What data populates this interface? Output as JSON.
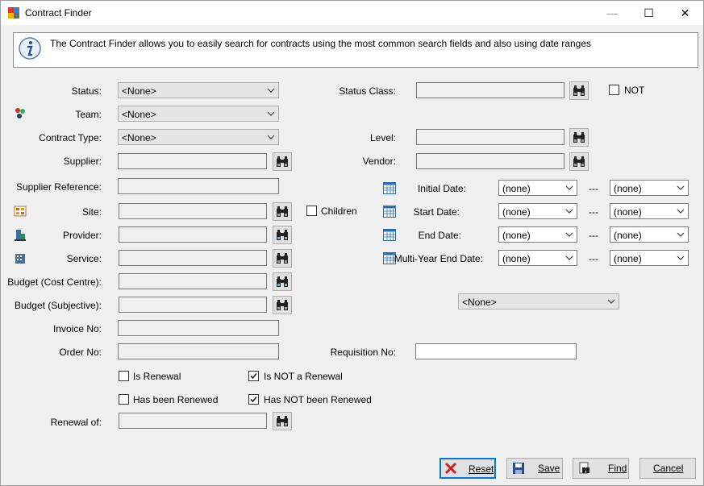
{
  "window": {
    "title": "Contract Finder",
    "minimize_glyph": "—",
    "maximize_glyph": "☐",
    "close_glyph": "✕"
  },
  "info": {
    "text": "The Contract Finder allows you to easily search for contracts using the most common search fields and also using date ranges",
    "icon": "info-icon"
  },
  "labels": {
    "status": "Status:",
    "team": "Team:",
    "contract_type": "Contract Type:",
    "supplier": "Supplier:",
    "supplier_reference": "Supplier Reference:",
    "site": "Site:",
    "provider": "Provider:",
    "service": "Service:",
    "budget_cost_centre": "Budget (Cost Centre):",
    "budget_subjective": "Budget (Subjective):",
    "invoice_no": "Invoice No:",
    "order_no": "Order No:",
    "renewal_of": "Renewal of:",
    "status_class": "Status Class:",
    "level": "Level:",
    "vendor": "Vendor:",
    "initial_date": "Initial Date:",
    "start_date": "Start Date:",
    "end_date": "End Date:",
    "multi_year_end_date": "Multi-Year End Date:",
    "requisition_no": "Requisition No:",
    "date_separator": "---"
  },
  "combos": {
    "status": "<None>",
    "team": "<None>",
    "contract_type": "<None>",
    "extra": "<None>"
  },
  "dates": {
    "initial_from": "(none)",
    "initial_to": "(none)",
    "start_from": "(none)",
    "start_to": "(none)",
    "end_from": "(none)",
    "end_to": "(none)",
    "multi_from": "(none)",
    "multi_to": "(none)"
  },
  "checkboxes": {
    "not": {
      "label": "NOT",
      "checked": false
    },
    "children": {
      "label": "Children",
      "checked": false
    },
    "is_renewal": {
      "label": "Is Renewal",
      "checked": false
    },
    "is_not_renewal": {
      "label": "Is NOT a Renewal",
      "checked": true
    },
    "has_been_renewed": {
      "label": "Has been Renewed",
      "checked": false
    },
    "has_not_been_renewed": {
      "label": "Has NOT been Renewed",
      "checked": true
    }
  },
  "buttons": {
    "reset": "Reset",
    "save": "Save",
    "find": "Find",
    "cancel": "Cancel"
  },
  "colors": {
    "accent": "#0078d7",
    "reset_red": "#d11f1f",
    "calendar_blue": "#2b6cb0"
  }
}
